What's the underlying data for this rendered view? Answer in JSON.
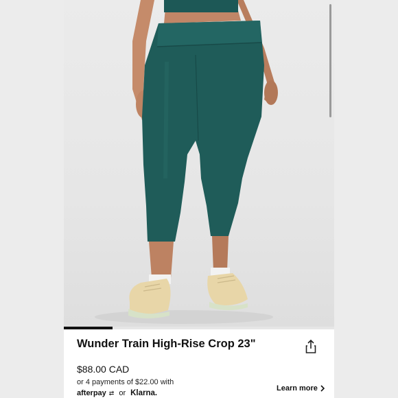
{
  "product": {
    "title": "Wunder Train High-Rise Crop 23\"",
    "price": "$88.00 CAD",
    "installments_text": "or 4 payments of $22.00 with",
    "afterpay_label": "afterpay",
    "or_label": "or",
    "klarna_label": "Klarna.",
    "learn_more_label": "Learn more"
  },
  "gallery": {
    "image_progress": 0.18,
    "legging_color": "#1e5a57",
    "shoe_color": "#e8d6a8"
  },
  "icons": {
    "share": "share-icon",
    "chevron": "chevron-right-icon",
    "afterpay": "afterpay-loop-icon"
  }
}
